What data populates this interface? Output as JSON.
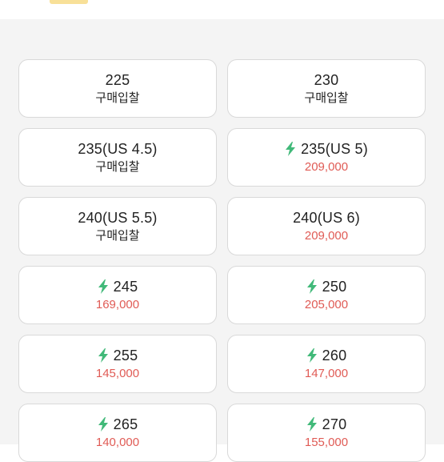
{
  "colors": {
    "bolt": "#41b979",
    "price": "#e05b55",
    "text": "#222222",
    "card_border": "#d9d9d9",
    "background": "#f4f4f4"
  },
  "sizes": [
    {
      "size": "225",
      "sub": "구매입찰",
      "kind": "bid",
      "fast": false
    },
    {
      "size": "230",
      "sub": "구매입찰",
      "kind": "bid",
      "fast": false
    },
    {
      "size": "235(US 4.5)",
      "sub": "구매입찰",
      "kind": "bid",
      "fast": false
    },
    {
      "size": "235(US 5)",
      "sub": "209,000",
      "kind": "price",
      "fast": true,
      "icon": "lightning-bolt-icon"
    },
    {
      "size": "240(US 5.5)",
      "sub": "구매입찰",
      "kind": "bid",
      "fast": false
    },
    {
      "size": "240(US 6)",
      "sub": "209,000",
      "kind": "price",
      "fast": false
    },
    {
      "size": "245",
      "sub": "169,000",
      "kind": "price",
      "fast": true,
      "icon": "lightning-bolt-icon"
    },
    {
      "size": "250",
      "sub": "205,000",
      "kind": "price",
      "fast": true,
      "icon": "lightning-bolt-icon"
    },
    {
      "size": "255",
      "sub": "145,000",
      "kind": "price",
      "fast": true,
      "icon": "lightning-bolt-icon"
    },
    {
      "size": "260",
      "sub": "147,000",
      "kind": "price",
      "fast": true,
      "icon": "lightning-bolt-icon"
    },
    {
      "size": "265",
      "sub": "140,000",
      "kind": "price",
      "fast": true,
      "icon": "lightning-bolt-icon"
    },
    {
      "size": "270",
      "sub": "155,000",
      "kind": "price",
      "fast": true,
      "icon": "lightning-bolt-icon"
    }
  ]
}
